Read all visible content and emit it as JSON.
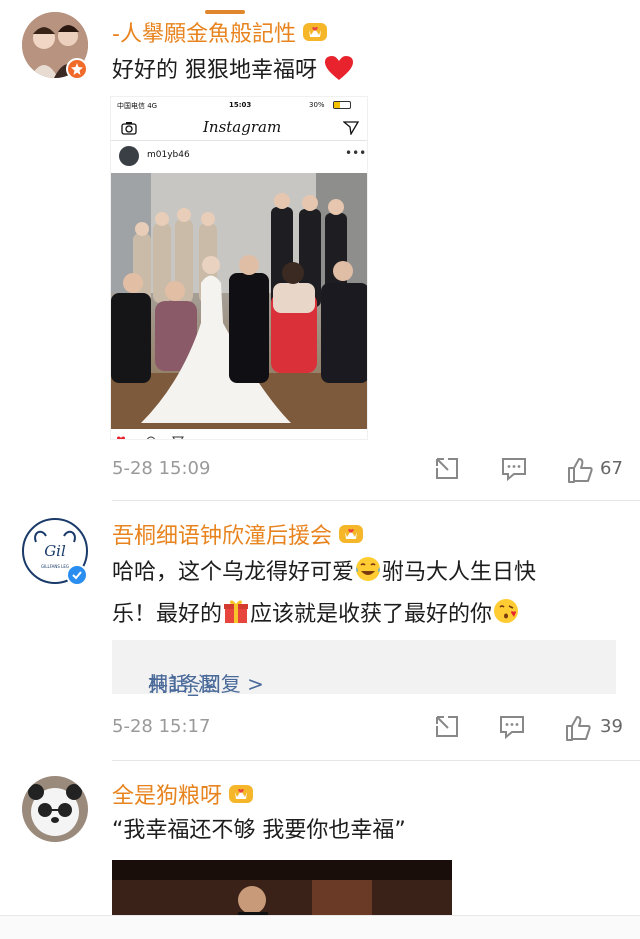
{
  "comments": [
    {
      "username": "-人擧願金魚般記性",
      "text": "好好的 狠狠地幸福呀",
      "time": "5-28 15:09",
      "likes": "67",
      "embedded_post": {
        "status_carrier": "中国电信 4G",
        "status_time": "15:03",
        "status_battery": "30%",
        "app_name": "Instagram",
        "post_user": "m01yb46"
      }
    },
    {
      "username": "吾桐细语钟欣潼后援会",
      "text_line1": "哈哈，这个乌龙得好可爱",
      "text_line1b": "驸马大人生日快",
      "text_line2a": "乐！最好的",
      "text_line2b": "应该就是收获了最好的你",
      "avatar_text": "Gil",
      "avatar_subtext": "GILLFANS LEG",
      "reply_user": "桐話_潔",
      "reply_count": "共1条回复 >",
      "time": "5-28 15:17",
      "likes": "39"
    },
    {
      "username": "全是狗粮呀",
      "text": "“我幸福还不够 我要你也幸福”"
    }
  ],
  "icons": {
    "share": "share-icon",
    "comment": "comment-icon",
    "like": "thumbs-up-icon",
    "heart": "red-heart-emoji",
    "crown": "crown-heart-badge",
    "laugh": "tears-of-joy-emoji",
    "gift": "gift-emoji",
    "kiss": "kissing-heart-emoji"
  },
  "colors": {
    "username": "#e8841f",
    "reply_link": "#4a6a9a",
    "meta": "#9a9a9a"
  }
}
